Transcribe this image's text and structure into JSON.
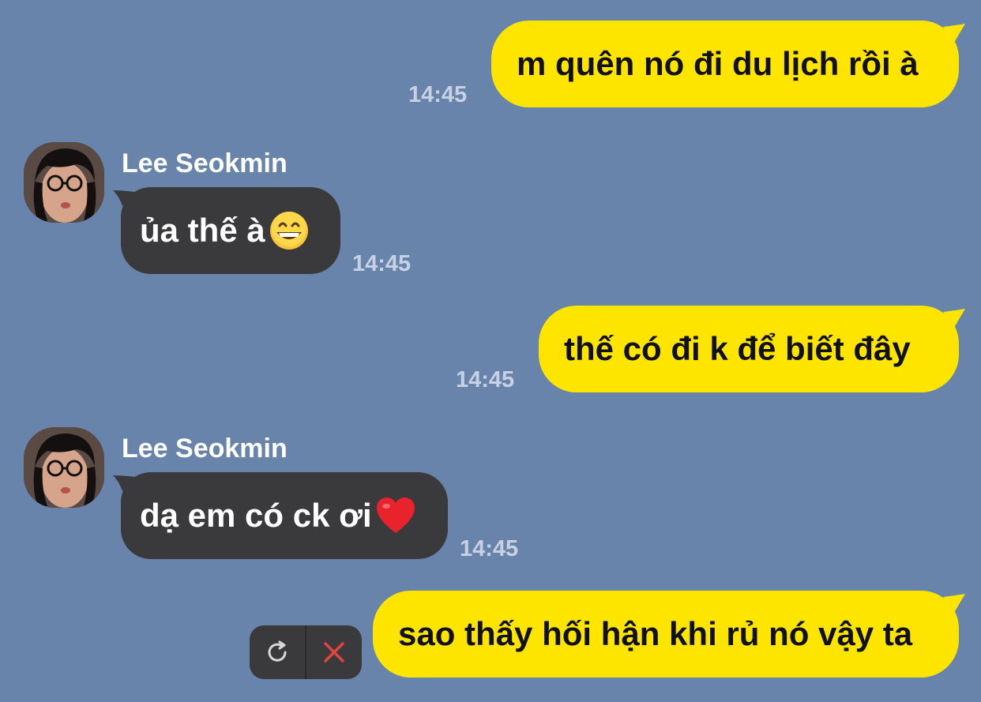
{
  "messages": [
    {
      "type": "out",
      "text": "m quên nó đi du lịch rồi à",
      "time": "14:45"
    },
    {
      "type": "in",
      "sender": "Lee Seokmin",
      "text": "ủa thế à",
      "emoji": "grinning-face",
      "time": "14:45"
    },
    {
      "type": "out",
      "text": "thế có đi k để biết đây",
      "time": "14:45"
    },
    {
      "type": "in",
      "sender": "Lee Seokmin",
      "text": "dạ em có ck ơi",
      "emoji": "red-heart",
      "time": "14:45"
    },
    {
      "type": "out",
      "text": "sao thấy hối hận khi rủ nó vậy ta",
      "time": "",
      "status": "failed"
    }
  ],
  "failed_actions": {
    "retry_icon": "retry-icon",
    "delete_icon": "close-icon"
  },
  "colors": {
    "background": "#6884ab",
    "outgoing_bubble": "#fee500",
    "incoming_bubble": "#3a3a3c",
    "timestamp": "#c6d2e3",
    "delete_icon": "#e0453f"
  }
}
